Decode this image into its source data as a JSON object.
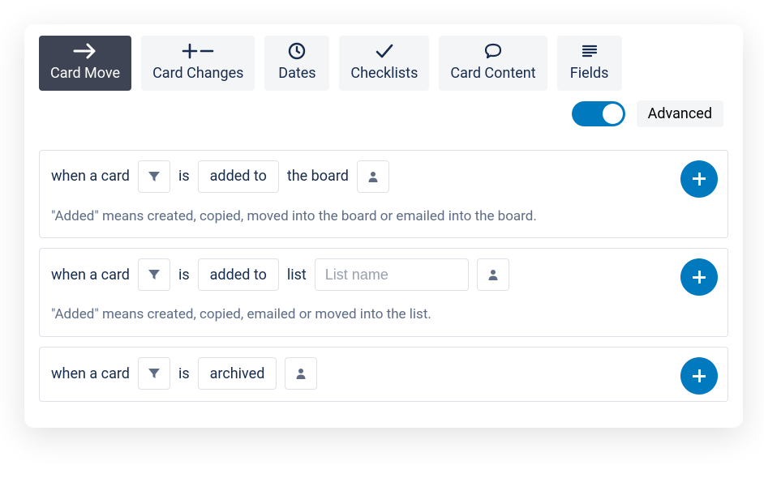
{
  "tabs": {
    "card_move": "Card Move",
    "card_changes": "Card Changes",
    "dates": "Dates",
    "checklists": "Checklists",
    "card_content": "Card Content",
    "fields": "Fields"
  },
  "advanced_label": "Advanced",
  "advanced_on": true,
  "strings": {
    "when_a_card": "when a card",
    "is": "is",
    "the_board": "the board",
    "list": "list"
  },
  "rules": [
    {
      "action": "added to",
      "target_kind": "board",
      "description": "\"Added\" means created, copied, moved into the board or emailed into the board."
    },
    {
      "action": "added to",
      "target_kind": "list",
      "list_placeholder": "List name",
      "description": "\"Added\" means created, copied, emailed or moved into the list."
    },
    {
      "action": "archived",
      "target_kind": "none"
    }
  ]
}
